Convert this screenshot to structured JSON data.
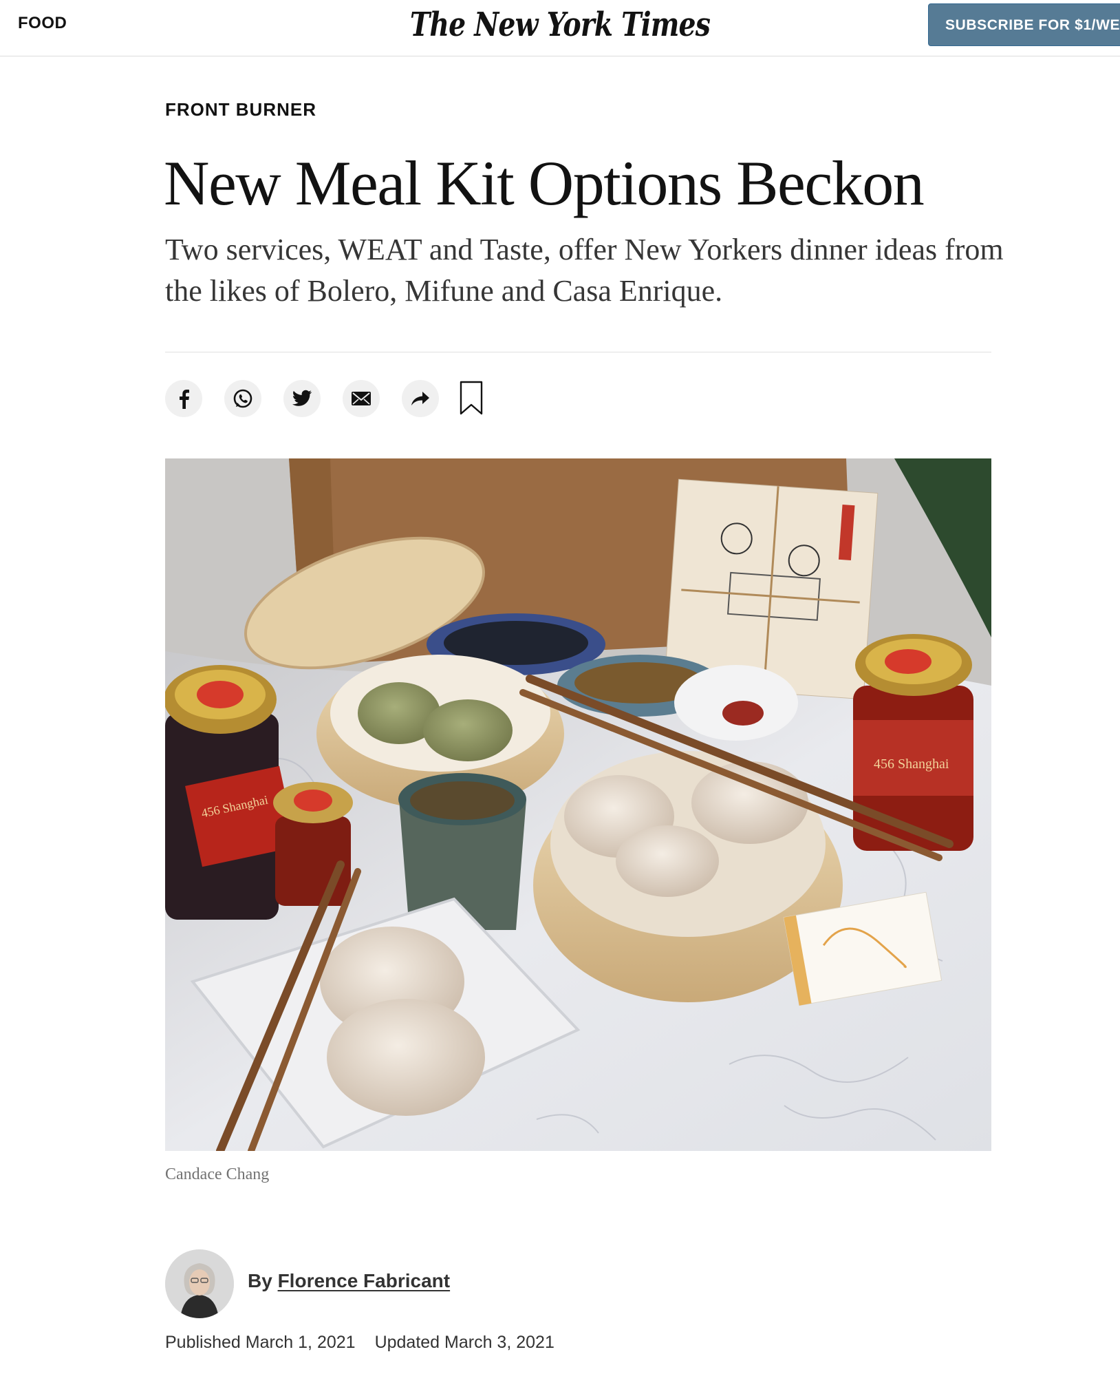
{
  "header": {
    "section_label": "FOOD",
    "masthead": "The New York Times",
    "subscribe_label": "SUBSCRIBE FOR $1/WE"
  },
  "article": {
    "kicker": "FRONT BURNER",
    "headline": "New Meal Kit Options Beckon",
    "summary": "Two services, WEAT and Taste, offer New Yorkers dinner ideas from the likes of Bolero, Mifune and Casa Enrique.",
    "photo_credit": "Candace Chang",
    "byline_prefix": "By",
    "author": "Florence Fabricant",
    "published": "Published March 1, 2021",
    "updated": "Updated March 3, 2021"
  },
  "photo_labels": {
    "jar_label_left": "456 Shanghai",
    "jar_label_right": "456 Shanghai"
  },
  "share_tools": [
    {
      "name": "facebook",
      "icon": "facebook-icon"
    },
    {
      "name": "whatsapp",
      "icon": "whatsapp-icon"
    },
    {
      "name": "twitter",
      "icon": "twitter-icon"
    },
    {
      "name": "email",
      "icon": "email-icon"
    },
    {
      "name": "more",
      "icon": "share-arrow-icon"
    },
    {
      "name": "save",
      "icon": "bookmark-icon"
    }
  ],
  "colors": {
    "subscribe_bg": "#567b95",
    "text": "#121212",
    "share_bg": "#f0f0f0"
  }
}
